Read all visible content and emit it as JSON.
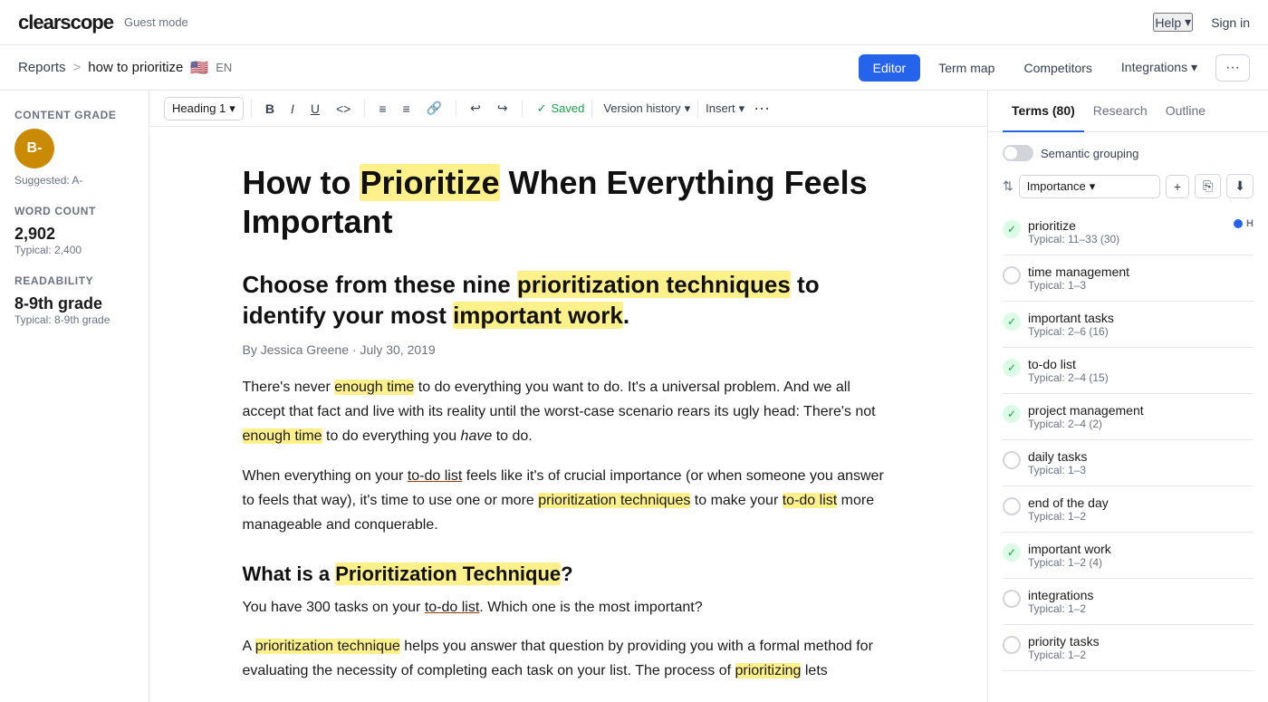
{
  "topnav": {
    "logo": "clearscope",
    "guest_mode": "Guest mode",
    "help": "Help",
    "sign_in": "Sign in"
  },
  "breadcrumb": {
    "reports": "Reports",
    "separator": ">",
    "current": "how to prioritize",
    "flag": "🇺🇸",
    "lang": "EN",
    "btn_editor": "Editor",
    "btn_term_map": "Term map",
    "btn_competitors": "Competitors",
    "btn_integrations": "Integrations",
    "btn_more": "···"
  },
  "sidebar": {
    "content_grade_label": "Content grade",
    "grade": "B-",
    "suggested_label": "Suggested: A-",
    "word_count_label": "Word count",
    "word_count": "2,902",
    "word_count_typical": "Typical: 2,400",
    "readability_label": "Readability",
    "readability": "8-9th grade",
    "readability_typical": "Typical: 8-9th grade"
  },
  "toolbar": {
    "heading_select": "Heading 1",
    "bold": "B",
    "italic": "I",
    "underline": "U",
    "code": "<>",
    "ul": "≡",
    "ol": "≡",
    "link": "🔗",
    "undo": "↩",
    "redo": "↪",
    "saved": "Saved",
    "version_history": "Version history",
    "insert": "Insert",
    "more": "···"
  },
  "article": {
    "title_plain": "How to Prioritize When Everything Feels Important",
    "title_highlight": "Prioritize",
    "subtitle": "Choose from these nine prioritization techniques to identify your most important work.",
    "byline": "By Jessica Greene · July 30, 2019",
    "paragraph1": "There's never enough time to do everything you want to do. It's a universal problem. And we all accept that fact and live with its reality until the worst-case scenario rears its ugly head: There's not enough time to do everything you have to do.",
    "paragraph2": "When everything on your to-do list feels like it's of crucial importance (or when someone you answer to feels that way), it's time to use one or more prioritization techniques to make your to-do list more manageable and conquerable.",
    "h3": "What is a Prioritization Technique?",
    "paragraph3": "You have 300 tasks on your to-do list. Which one is the most important?",
    "paragraph4": "A prioritization technique helps you answer that question by providing you with a formal method for evaluating the necessity of completing each task on your list. The process of prioritizing lets"
  },
  "right_panel": {
    "tabs": [
      {
        "label": "Terms (80)",
        "active": true
      },
      {
        "label": "Research",
        "active": false
      },
      {
        "label": "Outline",
        "active": false
      }
    ],
    "semantic_grouping": "Semantic grouping",
    "sort_label": "Importance",
    "terms": [
      {
        "name": "prioritize",
        "typical": "Typical: 11–33 (30)",
        "status": "done",
        "badge_blue": true,
        "badge_h": "H"
      },
      {
        "name": "time management",
        "typical": "Typical: 1–3",
        "status": "empty",
        "badge_blue": false,
        "badge_h": ""
      },
      {
        "name": "important tasks",
        "typical": "Typical: 2–6 (16)",
        "status": "done",
        "badge_blue": false,
        "badge_h": ""
      },
      {
        "name": "to-do list",
        "typical": "Typical: 2–4 (15)",
        "status": "done",
        "badge_blue": false,
        "badge_h": ""
      },
      {
        "name": "project management",
        "typical": "Typical: 2–4 (2)",
        "status": "done",
        "badge_blue": false,
        "badge_h": ""
      },
      {
        "name": "daily tasks",
        "typical": "Typical: 1–3",
        "status": "empty",
        "badge_blue": false,
        "badge_h": ""
      },
      {
        "name": "end of the day",
        "typical": "Typical: 1–2",
        "status": "empty",
        "badge_blue": false,
        "badge_h": ""
      },
      {
        "name": "important work",
        "typical": "Typical: 1–2 (4)",
        "status": "done",
        "badge_blue": false,
        "badge_h": ""
      },
      {
        "name": "integrations",
        "typical": "Typical: 1–2",
        "status": "empty",
        "badge_blue": false,
        "badge_h": ""
      },
      {
        "name": "priority tasks",
        "typical": "Typical: 1–2",
        "status": "empty",
        "badge_blue": false,
        "badge_h": ""
      }
    ]
  }
}
